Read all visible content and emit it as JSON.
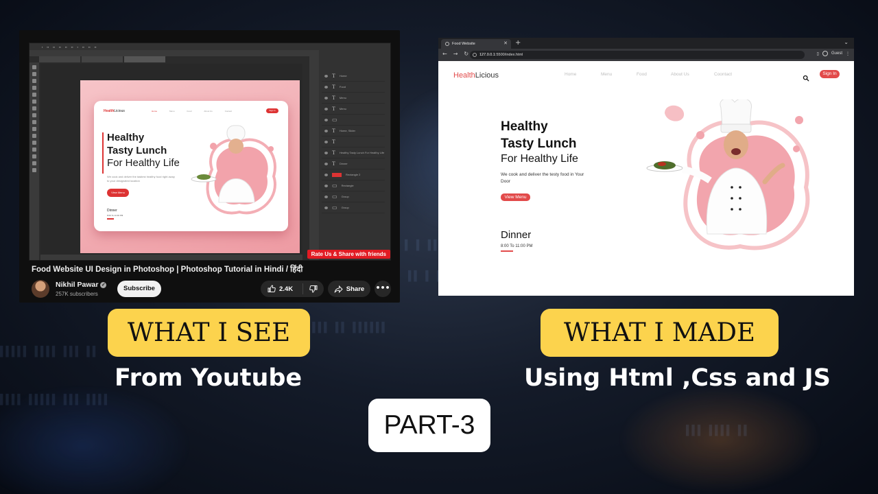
{
  "youtube": {
    "video_title": "Food Website UI Design in Photoshop | Photoshop Tutorial in Hindi / हिंदी",
    "channel_name": "Nikhil Pawar",
    "subscribers": "257K subscribers",
    "subscribe_label": "Subscribe",
    "likes": "2.4K",
    "share_label": "Share",
    "more_label": "•••",
    "overlay_badge": "Rate Us & Share with friends",
    "preview": {
      "logo_accent": "Health",
      "logo_rest": "Licious",
      "nav": [
        "Home",
        "Menu",
        "Food",
        "About Us",
        "Contact"
      ],
      "signin": "Sign In",
      "headline_line1": "Healthy",
      "headline_line2": "Tasty Lunch",
      "subheadline": "For Healthy Life",
      "paragraph": "We cook and deliver the tastiest healthy food right away to your designated location",
      "button": "View Menu",
      "dinner": "Dinner",
      "time": "8:00 To 11:00 PM"
    },
    "layers": [
      "Home",
      "Food",
      "Menu",
      "Menu",
      "",
      "Home, Slider",
      "",
      "Healthy Tasty Lunch For Healthy Life",
      "Dinner",
      "Rectangle 2",
      "Rectangle",
      "Group",
      "Group"
    ]
  },
  "browser": {
    "tab_title": "Food Website",
    "url_host": "127.0.0.1",
    "url_path": ":5500/index.html",
    "guest_label": "Guest",
    "site": {
      "logo_accent": "Health",
      "logo_rest": "Licious",
      "nav": [
        "Home",
        "Menu",
        "Food",
        "About Us",
        "Coontact"
      ],
      "signin": "Sign In",
      "headline_line1": "Healthy",
      "headline_line2": "Tasty Lunch",
      "subheadline": "For Healthy Life",
      "paragraph": "We cook and deliver the testy food in Your Door",
      "button": "View Menu",
      "dinner": "Dinner",
      "time": "8:00 To 11:00 PM"
    }
  },
  "labels": {
    "left_title": "WHAT I SEE",
    "left_subtitle": "From Youtube",
    "right_title": "WHAT I MADE",
    "right_subtitle": "Using Html ,Css and JS",
    "part": "PART-3"
  },
  "colors": {
    "accent_red": "#e24a4a",
    "label_yellow": "#fcd34d",
    "youtube_bg": "#0f0f0f"
  }
}
